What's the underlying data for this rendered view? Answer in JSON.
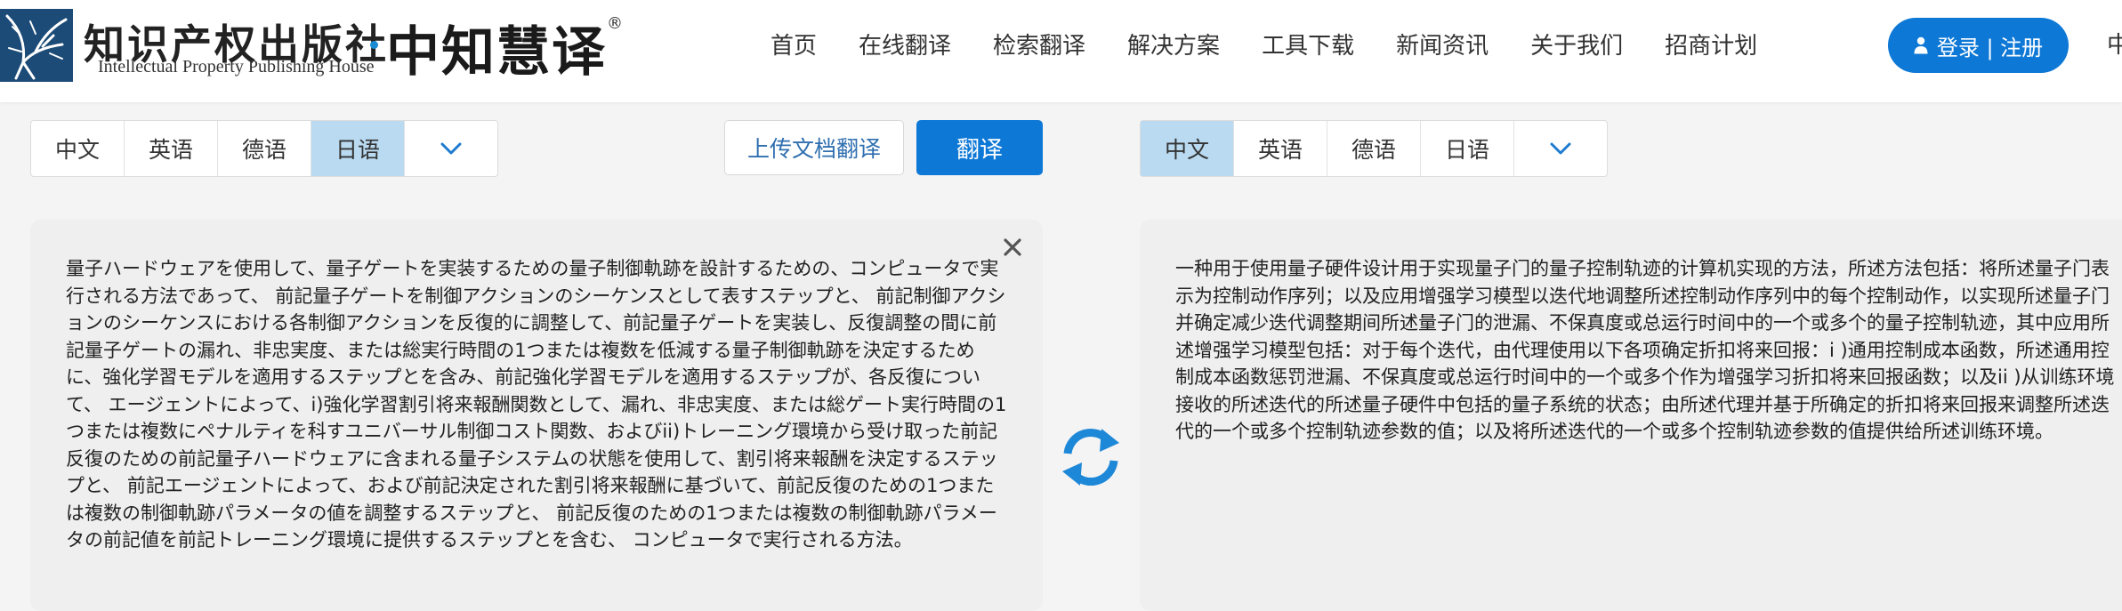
{
  "brand": {
    "publisher_cn": "知识产权出版社",
    "publisher_en": "Intellectual Property Publishing House",
    "product_cn": "中知慧译",
    "registered_mark": "®"
  },
  "nav": {
    "items": [
      "首页",
      "在线翻译",
      "检索翻译",
      "解决方案",
      "工具下载",
      "新闻资讯",
      "关于我们",
      "招商计划"
    ]
  },
  "header": {
    "login_label": "登录 | 注册",
    "lang_switch": "中"
  },
  "source_langs": {
    "items": [
      "中文",
      "英语",
      "德语",
      "日语"
    ],
    "active": "日语"
  },
  "target_langs": {
    "items": [
      "中文",
      "英语",
      "德语",
      "日语"
    ],
    "active": "中文"
  },
  "actions": {
    "upload_label": "上传文档翻译",
    "translate_label": "翻译"
  },
  "source": {
    "text": "量子ハードウェアを使用して、量子ゲートを実装するための量子制御軌跡を設計するための、コンピュータで実行される方法であって、 前記量子ゲートを制御アクションのシーケンスとして表すステップと、 前記制御アクションのシーケンスにおける各制御アクションを反復的に調整して、前記量子ゲートを実装し、反復調整の間に前記量子ゲートの漏れ、非忠実度、または総実行時間の1つまたは複数を低減する量子制御軌跡を決定するために、強化学習モデルを適用するステップとを含み、前記強化学習モデルを適用するステップが、各反復について、 エージェントによって、i)強化学習割引将来報酬関数として、漏れ、非忠実度、または総ゲート実行時間の1つまたは複数にペナルティを科すユニバーサル制御コスト関数、およびii)トレーニング環境から受け取った前記反復のための前記量子ハードウェアに含まれる量子システムの状態を使用して、割引将来報酬を決定するステップと、 前記エージェントによって、および前記決定された割引将来報酬に基づいて、前記反復のための1つまたは複数の制御軌跡パラメータの値を調整するステップと、 前記反復のための1つまたは複数の制御軌跡パラメータの前記値を前記トレーニング環境に提供するステップとを含む、 コンピュータで実行される方法。"
  },
  "target": {
    "text": "一种用于使用量子硬件设计用于实现量子门的量子控制轨迹的计算机实现的方法，所述方法包括：将所述量子门表示为控制动作序列；以及应用增强学习模型以迭代地调整所述控制动作序列中的每个控制动作，以实现所述量子门并确定减少迭代调整期间所述量子门的泄漏、不保真度或总运行时间中的一个或多个的量子控制轨迹，其中应用所述增强学习模型包括：对于每个迭代，由代理使用以下各项确定折扣将来回报：i )通用控制成本函数，所述通用控制成本函数惩罚泄漏、不保真度或总运行时间中的一个或多个作为增强学习折扣将来回报函数；以及ii )从训练环境接收的所述迭代的所述量子硬件中包括的量子系统的状态；由所述代理并基于所确定的折扣将来回报来调整所述迭代的一个或多个控制轨迹参数的值；以及将所述迭代的一个或多个控制轨迹参数的值提供给所述训练环境。"
  },
  "colors": {
    "primary": "#0e78d6",
    "active_lang_bg": "#b9daf1",
    "logo_bg": "#1c4b77",
    "swap_icon": "#1e88d8"
  }
}
